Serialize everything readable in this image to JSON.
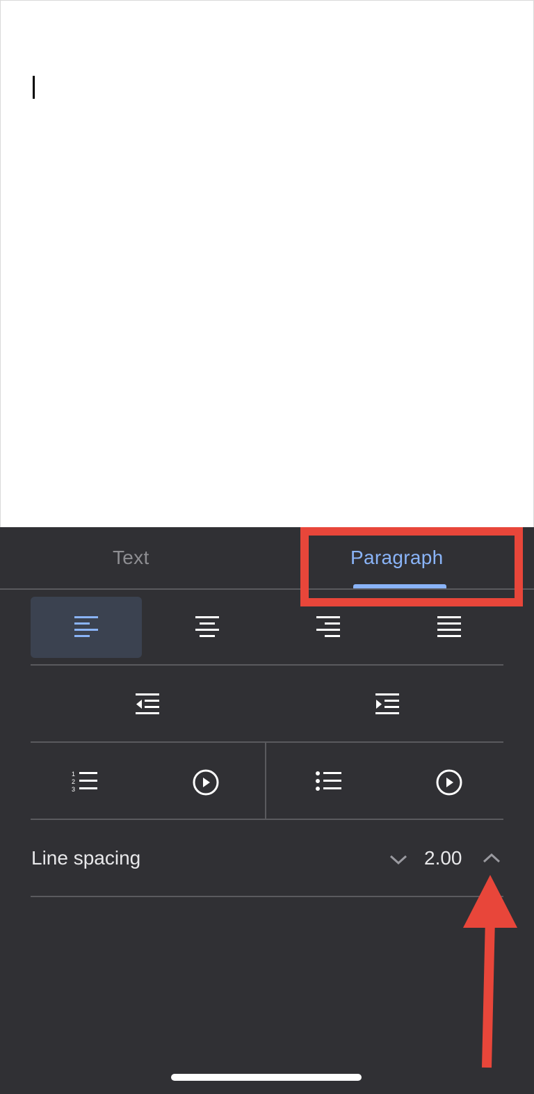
{
  "document": {
    "content": ""
  },
  "tabs": [
    {
      "label": "Text",
      "selected": false
    },
    {
      "label": "Paragraph",
      "selected": true
    }
  ],
  "alignment": {
    "options": [
      "align-left",
      "align-center",
      "align-right",
      "justify"
    ],
    "selected": "align-left"
  },
  "indent": {
    "options": [
      "decrease-indent",
      "increase-indent"
    ]
  },
  "lists": {
    "options": [
      "numbered-list",
      "numbered-list-options",
      "bulleted-list",
      "bulleted-list-options"
    ]
  },
  "line_spacing": {
    "label": "Line spacing",
    "value": "2.00"
  },
  "colors": {
    "panel_bg": "#303034",
    "accent": "#8ab4f8",
    "annotation": "#e8463a",
    "active_bg": "#3b4250"
  }
}
